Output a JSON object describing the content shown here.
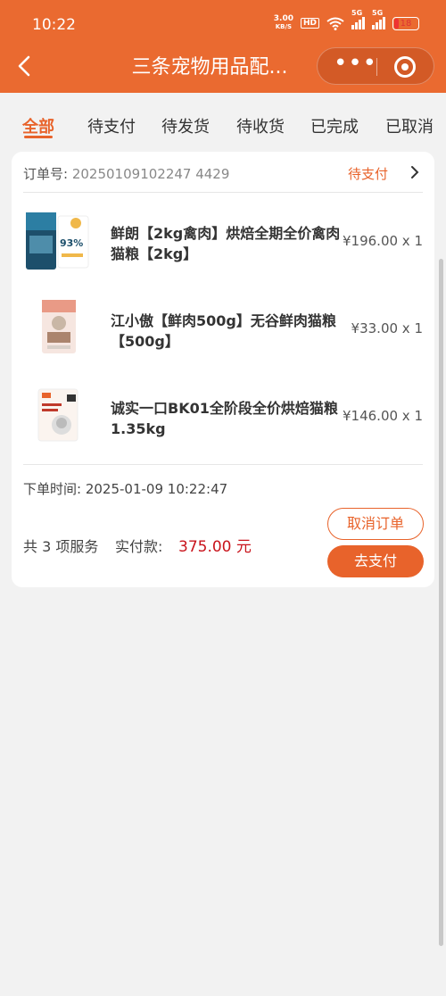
{
  "status_bar": {
    "time": "10:22",
    "net_speed_value": "3.00",
    "net_speed_unit": "KB/S",
    "hd_label": "HD",
    "signal1_label": "5G",
    "signal2_label": "5G",
    "battery": "18"
  },
  "header": {
    "title": "三条宠物用品配...",
    "more_label": "•••"
  },
  "tabs": [
    {
      "label": "全部",
      "active": true
    },
    {
      "label": "待支付",
      "active": false
    },
    {
      "label": "待发货",
      "active": false
    },
    {
      "label": "待收货",
      "active": false
    },
    {
      "label": "已完成",
      "active": false
    },
    {
      "label": "已取消",
      "active": false
    }
  ],
  "order": {
    "number_label": "订单号:",
    "number": "20250109102247 4429",
    "status": "待支付",
    "items": [
      {
        "name": "鲜朗【2kg禽肉】烘焙全期全价禽肉猫粮【2kg】",
        "price": "¥196.00 x 1",
        "image_text": "93%"
      },
      {
        "name": "江小傲【鲜肉500g】无谷鲜肉猫粮【500g】",
        "price": "¥33.00 x 1",
        "image_text": ""
      },
      {
        "name": "诚实一口BK01全阶段全价烘焙猫粮1.35kg",
        "price": "¥146.00 x 1",
        "image_text": ""
      }
    ],
    "time_label": "下单时间:",
    "time": "2025-01-09 10:22:47",
    "count_text": "共 3 项服务",
    "pay_label": "实付款:",
    "pay_amount": "375.00 元",
    "cancel_button": "取消订单",
    "pay_button": "去支付"
  },
  "colors": {
    "brand": "#ea6a30",
    "accent": "#e8632b",
    "price_red": "#c9141c",
    "background": "#f2f2f2"
  }
}
